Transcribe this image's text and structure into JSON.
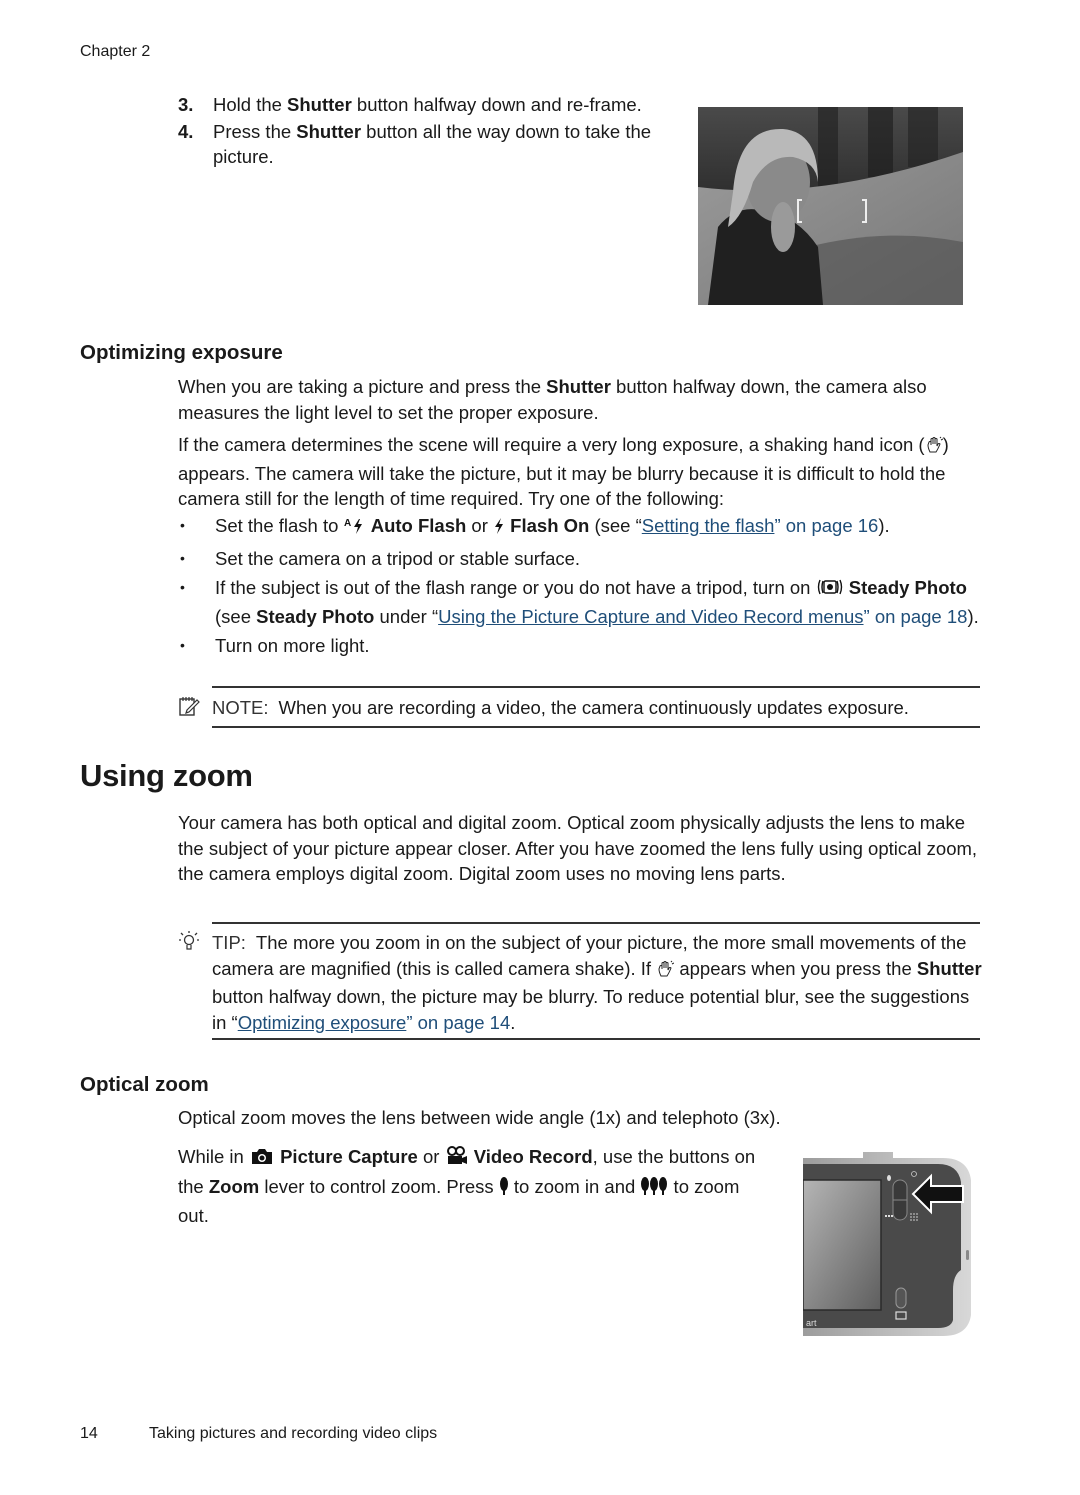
{
  "header": {
    "chapter": "Chapter 2"
  },
  "steps": [
    {
      "num": "3.",
      "pre": "Hold the ",
      "bold": "Shutter",
      "post": " button halfway down and re-frame."
    },
    {
      "num": "4.",
      "pre": "Press the ",
      "bold": "Shutter",
      "post": " button all the way down to take the picture."
    }
  ],
  "photo": {
    "description": "Black and white photo of a girl with focus brackets"
  },
  "optimizing": {
    "heading": "Optimizing exposure",
    "para1": {
      "pre": "When you are taking a picture and press the ",
      "bold": "Shutter",
      "post": " button halfway down, the camera also measures the light level to set the proper exposure."
    },
    "para2": {
      "pre": "If the camera determines the scene will require a very long exposure, a shaking hand icon (",
      "post": ") appears. The camera will take the picture, but it may be blurry because it is difficult to hold the camera still for the length of time required. Try one of the following:"
    },
    "bullets": {
      "b1": {
        "pre": "Set the flash to ",
        "bold1": "Auto Flash",
        "mid": " or ",
        "bold2": "Flash On",
        "open": " (see “",
        "link": "Setting the flash",
        "tail": "” on page 16",
        "close": ")."
      },
      "b2": {
        "text": "Set the camera on a tripod or stable surface."
      },
      "b3": {
        "pre": "If the subject is out of the flash range or you do not have a tripod, turn on ",
        "bold1": "Steady Photo",
        "mid": " (see ",
        "bold2": "Steady Photo",
        "mid2": " under “",
        "link": "Using the Picture Capture and Video Record menus",
        "tail": "” on page 18",
        "close": ")."
      },
      "b4": {
        "text": "Turn on more light."
      }
    },
    "note": {
      "label": "NOTE:",
      "text": "When you are recording a video, the camera continuously updates exposure."
    }
  },
  "using_zoom": {
    "heading": "Using zoom",
    "para": "Your camera has both optical and digital zoom. Optical zoom physically adjusts the lens to make the subject of your picture appear closer. After you have zoomed the lens fully using optical zoom, the camera employs digital zoom. Digital zoom uses no moving lens parts.",
    "tip": {
      "label": "TIP:",
      "pre": "The more you zoom in on the subject of your picture, the more small movements of the camera are magnified (this is called camera shake). If ",
      "mid": " appears when you press the ",
      "bold": "Shutter",
      "post": " button halfway down, the picture may be blurry. To reduce potential blur, see the suggestions in “",
      "link": "Optimizing exposure",
      "tail": "” on page 14",
      "close": "."
    }
  },
  "optical_zoom": {
    "heading": "Optical zoom",
    "para1": "Optical zoom moves the lens between wide angle (1x) and telephoto (3x).",
    "para2": {
      "pre": "While in ",
      "bold1": "Picture Capture",
      "mid": " or ",
      "bold2": "Video Record",
      "mid2": ", use the buttons on the ",
      "bold3": "Zoom",
      "mid3": " lever to control zoom. Press ",
      "mid4": " to zoom in and ",
      "post": " to zoom out."
    },
    "camera_image": {
      "brand_fragment": "art"
    }
  },
  "footer": {
    "page": "14",
    "title": "Taking pictures and recording video clips"
  },
  "colors": {
    "link": "#1f4e79",
    "text": "#1a1a1a",
    "rule": "#333333"
  }
}
